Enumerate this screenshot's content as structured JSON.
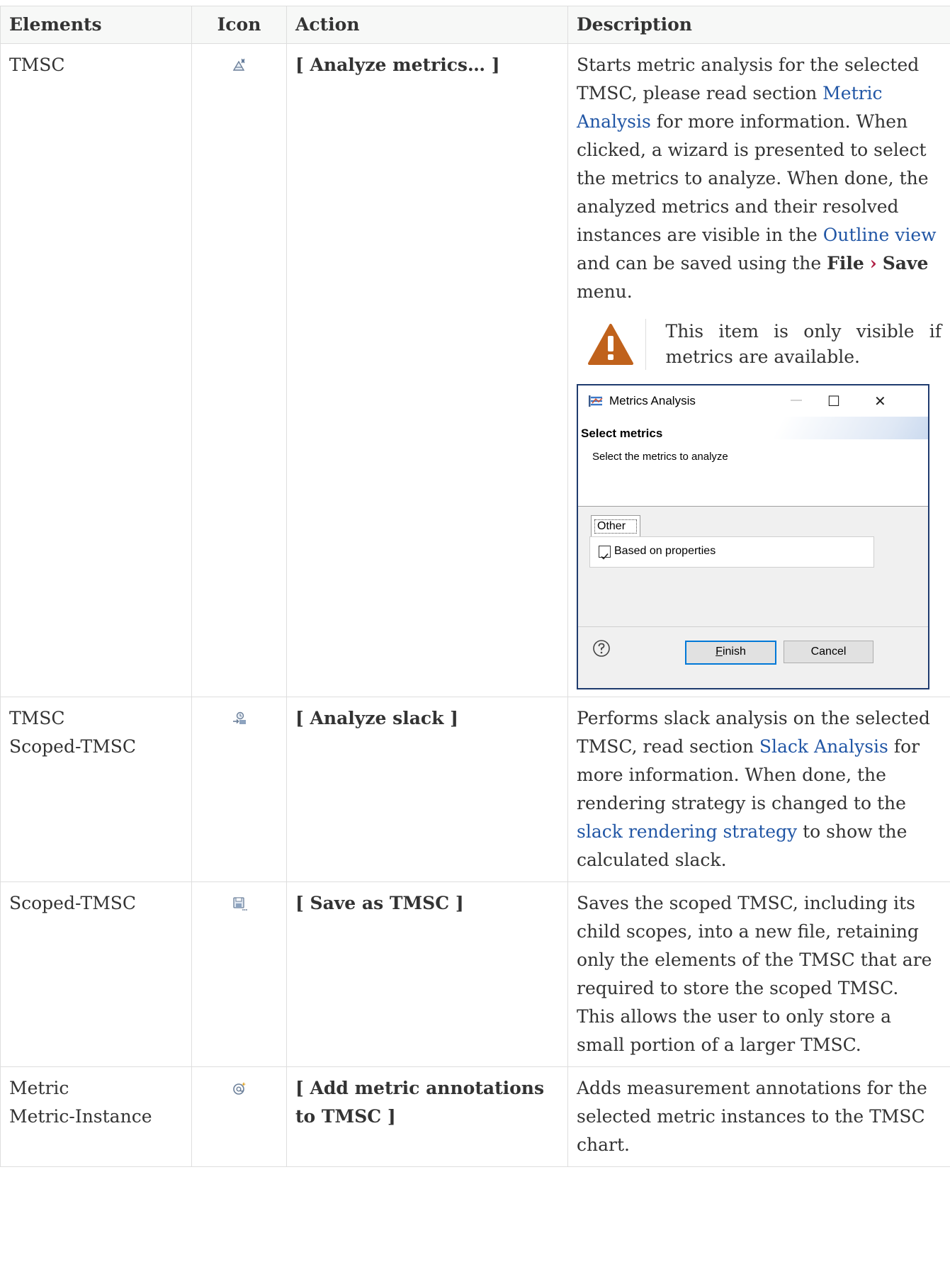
{
  "headers": {
    "elements": "Elements",
    "icon": "Icon",
    "action": "Action",
    "description": "Description"
  },
  "rows": [
    {
      "elements": [
        "TMSC"
      ],
      "icon": "analyze-metrics-icon",
      "action": "[ Analyze metrics… ]",
      "description": {
        "p1": "Starts metric analysis for the selected TMSC, please read section ",
        "link1": "Metric Analysis",
        "p2": " for more information. When clicked, a wizard is presented to select the metrics to analyze. When done, the analyzed metrics and their resolved instances are visible in the ",
        "link2": "Outline view",
        "p3": " and can be saved using the ",
        "menu_file": "File",
        "menu_sep": "›",
        "menu_save": "Save",
        "p4": " menu."
      },
      "warning": "This item is only visible if metrics are available.",
      "dialog": {
        "title": "Metrics Analysis",
        "heading": "Select metrics",
        "subtitle": "Select the metrics to analyze",
        "tab": "Other",
        "checkbox_label": "Based on properties",
        "checkbox_checked": true,
        "finish_mnemonic": "F",
        "finish_rest": "inish",
        "cancel": "Cancel",
        "minimize": "—",
        "maximize": "☐",
        "close": "✕"
      }
    },
    {
      "elements": [
        "TMSC",
        "Scoped-TMSC"
      ],
      "icon": "analyze-slack-icon",
      "action": "[ Analyze slack ]",
      "description": {
        "p1": "Performs slack analysis on the selected TMSC, read section ",
        "link1": "Slack Analysis",
        "p2": " for more information. When done, the rendering strategy is changed to the ",
        "link2": "slack rendering strategy",
        "p3": " to show the calculated slack."
      }
    },
    {
      "elements": [
        "Scoped-TMSC"
      ],
      "icon": "save-as-icon",
      "action": "[ Save as TMSC ]",
      "description": {
        "p1": "Saves the scoped TMSC, including its child scopes, into a new file, retaining only the elements of the TMSC that are required to store the scoped TMSC. This allows the user to only store a small portion of a larger TMSC."
      }
    },
    {
      "elements": [
        "Metric",
        "Metric-Instance"
      ],
      "icon": "add-annotation-icon",
      "action": "[ Add metric annotations to TMSC ]",
      "description": {
        "p1": "Adds measurement annotations for the selected metric instances to the TMSC chart."
      }
    }
  ],
  "colors": {
    "link": "#2156a5",
    "warning": "#c0621c",
    "menu_separator": "#b12146",
    "border": "#dedede"
  }
}
